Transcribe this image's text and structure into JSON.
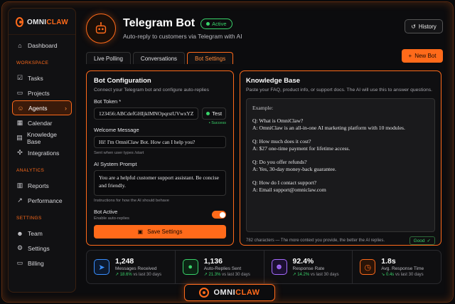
{
  "brand": {
    "name_a": "OMNI",
    "name_b": "CLAW"
  },
  "sidebar": {
    "items_top": [
      {
        "label": "Dashboard",
        "icon": "home-icon"
      }
    ],
    "workspace_title": "WORKSPACE",
    "workspace": [
      {
        "label": "Tasks",
        "icon": "checkbox-icon"
      },
      {
        "label": "Projects",
        "icon": "folder-icon"
      },
      {
        "label": "Agents",
        "icon": "agents-icon",
        "active": true
      },
      {
        "label": "Calendar",
        "icon": "calendar-icon"
      },
      {
        "label": "Knowledge Base",
        "icon": "book-icon"
      },
      {
        "label": "Integrations",
        "icon": "integrations-icon"
      }
    ],
    "analytics_title": "ANALYTICS",
    "analytics": [
      {
        "label": "Reports",
        "icon": "reports-icon"
      },
      {
        "label": "Performance",
        "icon": "performance-icon"
      }
    ],
    "settings_title": "SETTINGS",
    "settings": [
      {
        "label": "Team",
        "icon": "team-icon"
      },
      {
        "label": "Settings",
        "icon": "gear-icon"
      },
      {
        "label": "Billing",
        "icon": "billing-icon"
      }
    ]
  },
  "header": {
    "title": "Telegram Bot",
    "status": "Active",
    "subtitle": "Auto-reply to customers via Telegram with AI",
    "history_label": "History",
    "new_bot_label": "New Bot"
  },
  "tabs": [
    {
      "label": "Live Polling"
    },
    {
      "label": "Conversations"
    },
    {
      "label": "Bot Settings",
      "active": true
    }
  ],
  "config": {
    "title": "Bot Configuration",
    "desc": "Connect your Telegram bot and configure auto-replies",
    "token_label": "Bot Token *",
    "token_value": "123456:ABCdefGHIjklMNOpqrstUVwxYZ",
    "test_label": "Test",
    "test_status": "• Success",
    "welcome_label": "Welcome Message",
    "welcome_value": "Hi! I'm OmniClaw Bot. How can I help you?",
    "welcome_hint": "Sent when user types /start",
    "prompt_label": "AI System Prompt",
    "prompt_value": "You are a helpful customer support assistant. Be concise and friendly.",
    "prompt_hint": "Instructions for how the AI should behave",
    "active_label": "Bot Active",
    "active_hint": "Enable auto-replies",
    "active_on": true,
    "save_label": "Save Settings"
  },
  "kb": {
    "title": "Knowledge Base",
    "desc": "Paste your FAQ, product info, or support docs. The AI will use this to answer questions.",
    "example_label": "Example:",
    "qa": [
      {
        "q": "Q: What is OmniClaw?",
        "a": "A: OmniClaw is an all-in-one AI marketing platform with 10 modules."
      },
      {
        "q": "Q: How much does it cost?",
        "a": "A: $27 one-time payment for lifetime access."
      },
      {
        "q": "Q: Do you offer refunds?",
        "a": "A: Yes, 30-day money-back guarantee."
      },
      {
        "q": "Q: How do I contact support?",
        "a": "A: Email support@omniclaw.com"
      }
    ],
    "count_text": "782 characters — The more context you provide, the better the AI replies.",
    "quality_label": "Good"
  },
  "stats": [
    {
      "value": "1,248",
      "label": "Messages Received",
      "trend": "↗ 18.6%",
      "period": "vs last 30 days",
      "icon": "send-icon",
      "color": "#3a8fff"
    },
    {
      "value": "1,136",
      "label": "Auto-Replies Sent",
      "trend": "↗ 21.3%",
      "period": "vs last 30 days",
      "icon": "chat-icon",
      "color": "#39d36a"
    },
    {
      "value": "92.4%",
      "label": "Response Rate",
      "trend": "↗ 14.2%",
      "period": "vs last 30 days",
      "icon": "users-icon",
      "color": "#a66bff"
    },
    {
      "value": "1.8s",
      "label": "Avg. Response Time",
      "trend": "↘ 0.4s",
      "period": "vs last 30 days",
      "icon": "clock-icon",
      "color": "#ff6a1a"
    }
  ]
}
